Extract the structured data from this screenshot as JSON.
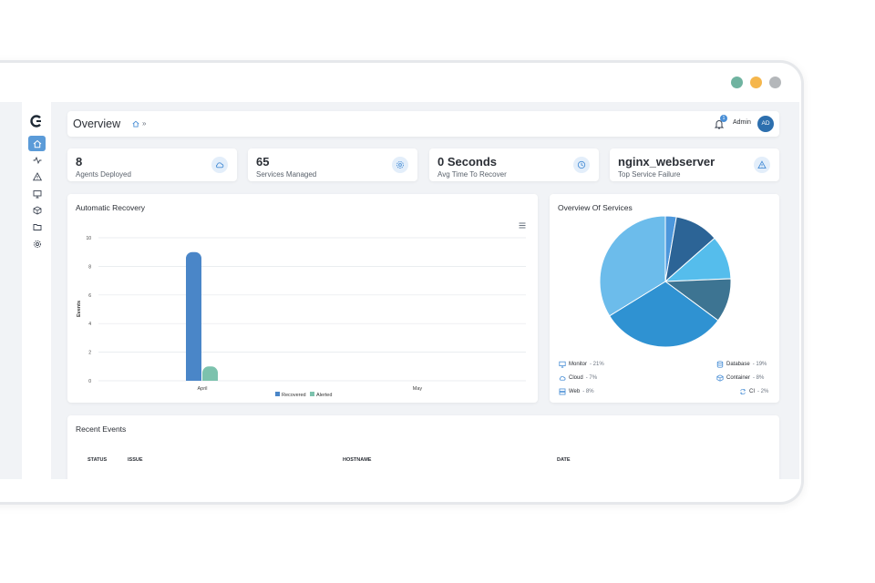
{
  "window_dots": [
    {
      "color": "#6fb3a0"
    },
    {
      "color": "#f5b64c"
    },
    {
      "color": "#b4b7ba"
    }
  ],
  "sidebar": {
    "logo": "c-logo-icon",
    "items": [
      {
        "icon": "home-icon",
        "active": true
      },
      {
        "icon": "activity-icon"
      },
      {
        "icon": "warning-icon"
      },
      {
        "icon": "monitor-icon"
      },
      {
        "icon": "cube-icon"
      },
      {
        "icon": "folder-icon"
      },
      {
        "icon": "gear-icon"
      }
    ]
  },
  "header": {
    "title": "Overview",
    "breadcrumb_icon": "home-icon",
    "breadcrumb_sep": "»",
    "notification_count": "1",
    "user_name": "Admin",
    "user_initials": "AD"
  },
  "stats": [
    {
      "value": "8",
      "label": "Agents Deployed",
      "icon": "cloud-icon"
    },
    {
      "value": "65",
      "label": "Services Managed",
      "icon": "gear-icon"
    },
    {
      "value": "0 Seconds",
      "label": "Avg Time To Recover",
      "icon": "clock-icon"
    },
    {
      "value": "nginx_webserver",
      "label": "Top Service Failure",
      "icon": "warning-icon"
    }
  ],
  "recovery_panel": {
    "title": "Automatic Recovery",
    "menu_icon": "hamburger-icon"
  },
  "services_panel": {
    "title": "Overview Of Services",
    "legend": [
      {
        "icon": "monitor-icon",
        "label": "Monitor",
        "pct": "- 21%"
      },
      {
        "icon": "database-icon",
        "label": "Database",
        "pct": "- 19%"
      },
      {
        "icon": "cloud-icon",
        "label": "Cloud",
        "pct": "- 7%"
      },
      {
        "icon": "cube-icon",
        "label": "Container",
        "pct": "- 8%"
      },
      {
        "icon": "server-icon",
        "label": "Web",
        "pct": "- 8%"
      },
      {
        "icon": "refresh-icon",
        "label": "CI",
        "pct": "- 2%"
      }
    ]
  },
  "events_panel": {
    "title": "Recent Events",
    "columns": [
      "STATUS",
      "ISSUE",
      "HOSTNAME",
      "DATE"
    ]
  },
  "chart_data": [
    {
      "type": "bar",
      "title": "Automatic Recovery",
      "xlabel": "",
      "ylabel": "Events",
      "categories": [
        "April",
        "May"
      ],
      "series": [
        {
          "name": "Recovered",
          "color": "#4a86c8",
          "values": [
            9,
            0
          ]
        },
        {
          "name": "Alerted",
          "color": "#7cc2ad",
          "values": [
            1,
            0
          ]
        }
      ],
      "ylim": [
        0,
        10
      ],
      "yticks": [
        "0",
        "2",
        "4",
        "6",
        "8",
        "10"
      ],
      "grid": true,
      "legend_position": "bottom"
    },
    {
      "type": "pie",
      "title": "Overview Of Services",
      "slices": [
        {
          "value": 2,
          "color": "#4c97dc"
        },
        {
          "value": 8,
          "color": "#2c6496"
        },
        {
          "value": 8,
          "color": "#55bdec"
        },
        {
          "value": 8,
          "color": "#3d7492"
        },
        {
          "value": 23,
          "color": "#2f92d2"
        },
        {
          "value": 25,
          "color": "#6cbceb"
        }
      ]
    }
  ]
}
